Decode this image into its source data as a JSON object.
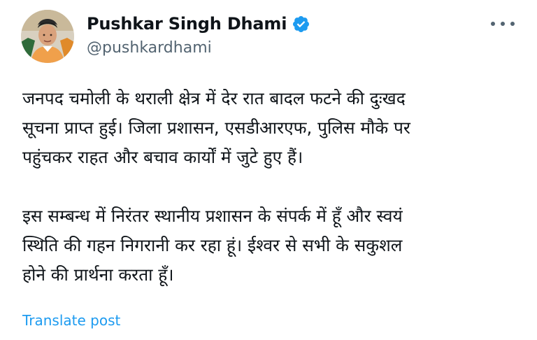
{
  "author": {
    "display_name": "Pushkar Singh Dhami",
    "handle": "@pushkardhami",
    "verified": true
  },
  "post": {
    "paragraph_1": [
      "जनपद चमोली के थराली क्षेत्र में देर रात बादल फटने की दुःखद",
      "सूचना प्राप्त हुई। जिला प्रशासन, एसडीआरएफ, पुलिस मौके पर",
      "पहुंचकर राहत और बचाव कार्यों में जुटे हुए हैं।"
    ],
    "paragraph_2": [
      "इस सम्बन्ध में निरंतर स्थानीय प्रशासन के संपर्क में हूँ और स्वयं",
      "स्थिति की गहन निगरानी कर रहा हूं। ईश्वर से सभी के सकुशल",
      "होने की प्रार्थना करता हूँ।"
    ]
  },
  "actions": {
    "translate_label": "Translate post",
    "more_icon": "more-horizontal-icon"
  },
  "colors": {
    "text_primary": "#0f1419",
    "text_secondary": "#536471",
    "link": "#1d9bf0",
    "verified": "#1d9bf0"
  }
}
